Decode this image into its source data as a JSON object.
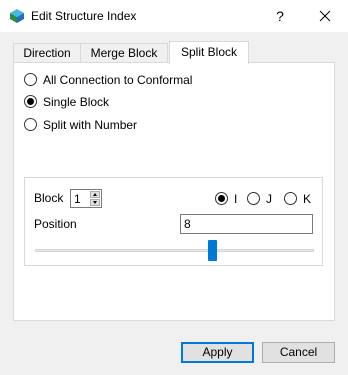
{
  "window": {
    "title": "Edit Structure Index",
    "help_label": "?",
    "icons": {
      "app": "structure-app-icon",
      "close": "close-icon"
    }
  },
  "tabs": [
    {
      "label": "Direction",
      "active": false
    },
    {
      "label": "Merge Block",
      "active": false
    },
    {
      "label": "Split Block",
      "active": true
    }
  ],
  "split_mode": {
    "options": [
      {
        "label": "All Connection to Conformal",
        "checked": false
      },
      {
        "label": "Single Block",
        "checked": true
      },
      {
        "label": "Split with Number",
        "checked": false
      }
    ]
  },
  "block_group": {
    "block_label": "Block",
    "block_value": "1",
    "direction_options": [
      {
        "label": "I",
        "checked": true
      },
      {
        "label": "J",
        "checked": false
      },
      {
        "label": "K",
        "checked": false
      }
    ],
    "position_label": "Position",
    "position_value": "8",
    "slider_level_fraction": 0.64
  },
  "buttons": {
    "apply": "Apply",
    "cancel": "Cancel"
  },
  "colors": {
    "accent": "#0078d7",
    "titlebar": "#ffffff",
    "background": "#f0f0f0"
  }
}
